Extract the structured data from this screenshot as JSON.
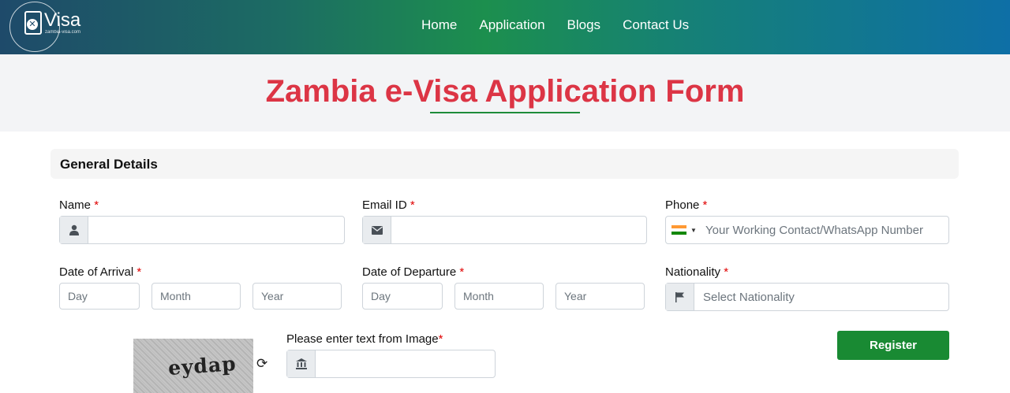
{
  "brand": {
    "name": "Visa",
    "domain": "zambia-visa.com"
  },
  "nav": [
    {
      "label": "Home"
    },
    {
      "label": "Application"
    },
    {
      "label": "Blogs"
    },
    {
      "label": "Contact Us"
    }
  ],
  "page": {
    "title": "Zambia e-Visa Application Form"
  },
  "section": {
    "title": "General Details"
  },
  "form": {
    "required_mark": "*",
    "name": {
      "label": "Name",
      "value": "",
      "icon": "user-icon"
    },
    "email": {
      "label": "Email ID",
      "value": "",
      "icon": "envelope-icon"
    },
    "phone": {
      "label": "Phone",
      "placeholder": "Your Working Contact/WhatsApp Number",
      "country_flag": "india-flag-icon"
    },
    "arrival": {
      "label": "Date of Arrival",
      "day": "Day",
      "month": "Month",
      "year": "Year"
    },
    "departure": {
      "label": "Date of Departure",
      "day": "Day",
      "month": "Month",
      "year": "Year"
    },
    "nationality": {
      "label": "Nationality",
      "placeholder": "Select Nationality",
      "icon": "flag-icon"
    },
    "captcha": {
      "label": "Please enter text from Image",
      "image_text": "eydap",
      "value": "",
      "icon": "bank-icon"
    },
    "register_label": "Register"
  },
  "colors": {
    "title": "#dc3545",
    "register": "#198a33",
    "required": "#e00000"
  }
}
